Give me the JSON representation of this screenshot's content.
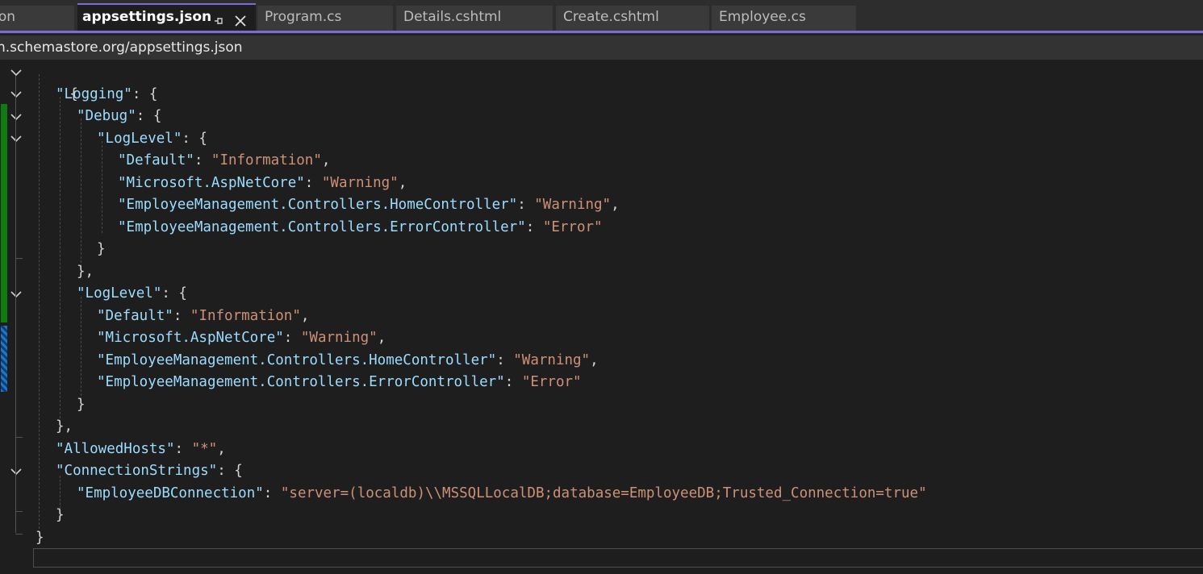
{
  "tabs": [
    {
      "label": "son",
      "active": false
    },
    {
      "label": "appsettings.json",
      "active": true
    },
    {
      "label": "Program.cs",
      "active": false
    },
    {
      "label": "Details.cshtml",
      "active": false
    },
    {
      "label": "Create.cshtml",
      "active": false
    },
    {
      "label": "Employee.cs",
      "active": false
    }
  ],
  "icons": {
    "pin": "pin-icon",
    "close": "close-icon",
    "fold": "chevron-down-icon"
  },
  "schema_url": "n.schemastore.org/appsettings.json",
  "colors": {
    "accent": "#7b6cd9",
    "json_key": "#9cdcfe",
    "json_string": "#ce9178",
    "punctuation": "#d4d4d4",
    "change_saved": "#107c10",
    "change_unsaved": "#1e74c9"
  },
  "code": {
    "open_root": "{",
    "logging_key": "\"Logging\"",
    "debug_key": "\"Debug\"",
    "loglevel_key": "\"LogLevel\"",
    "default_key": "\"Default\"",
    "information_value": "\"Information\"",
    "aspnetcore_key": "\"Microsoft.AspNetCore\"",
    "warning_value": "\"Warning\"",
    "home_controller_key": "\"EmployeeManagement.Controllers.HomeController\"",
    "error_controller_key": "\"EmployeeManagement.Controllers.ErrorController\"",
    "error_value": "\"Error\"",
    "allowed_hosts_key": "\"AllowedHosts\"",
    "allowed_hosts_value": "\"*\"",
    "connection_strings_key": "\"ConnectionStrings\"",
    "employee_db_key": "\"EmployeeDBConnection\"",
    "employee_db_value": "\"server=(localdb)\\\\MSSQLLocalDB;database=EmployeeDB;Trusted_Connection=true\"",
    "colon_open": ": {",
    "colon": ": ",
    "comma": ",",
    "close": "}",
    "close_comma": "},"
  }
}
